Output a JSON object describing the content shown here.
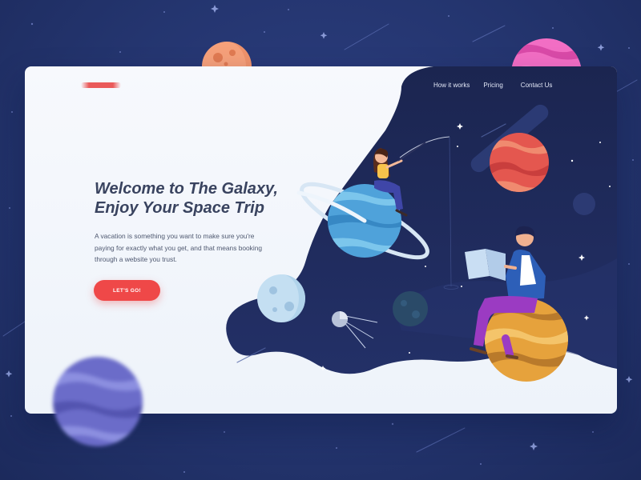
{
  "nav": {
    "items": [
      {
        "label": "How it works"
      },
      {
        "label": "Pricing"
      },
      {
        "label": "Contact Us"
      }
    ]
  },
  "hero": {
    "title_line1": "Welcome to The Galaxy,",
    "title_line2": "Enjoy Your Space Trip",
    "body": "A vacation is something you want to make sure you're paying for exactly what you get, and that means booking through a website you trust.",
    "cta_label": "LET'S GO!"
  },
  "colors": {
    "page_background": "#24356f",
    "card_background": "#f7f9fd",
    "space_navy": "#1c2750",
    "accent_red": "#ef4848",
    "heading_text": "#39435f"
  },
  "icons": [
    "logo-mark",
    "star-icon",
    "planet-illustration",
    "satellite-icon"
  ]
}
